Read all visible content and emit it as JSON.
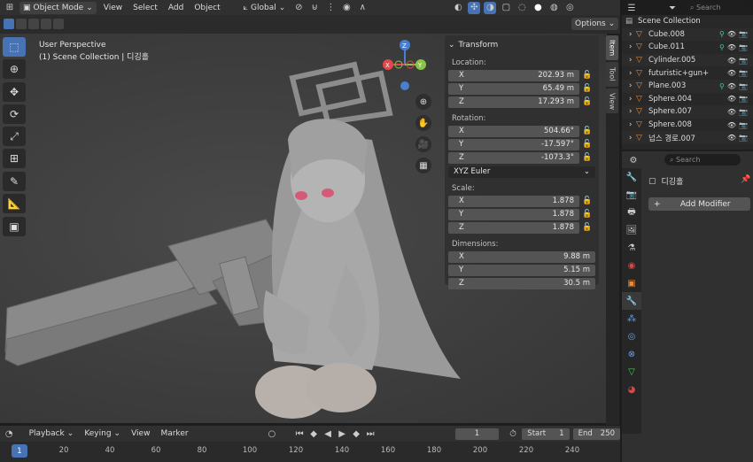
{
  "topbar": {
    "mode": "Object Mode",
    "menus": [
      "View",
      "Select",
      "Add",
      "Object"
    ],
    "orientation": "Global",
    "search_placeholder": "Search"
  },
  "viewport": {
    "view_name": "User Perspective",
    "context": "(1) Scene Collection | 디깅홀",
    "options_label": "Options"
  },
  "gizmo": {
    "x": "X",
    "y": "Y",
    "z": "Z"
  },
  "npanel": {
    "tabs": [
      "Item",
      "Tool",
      "View"
    ],
    "section": "Transform",
    "location_label": "Location:",
    "location": [
      {
        "axis": "X",
        "value": "202.93 m"
      },
      {
        "axis": "Y",
        "value": "65.49 m"
      },
      {
        "axis": "Z",
        "value": "17.293 m"
      }
    ],
    "rotation_label": "Rotation:",
    "rotation": [
      {
        "axis": "X",
        "value": "504.66°"
      },
      {
        "axis": "Y",
        "value": "-17.597°"
      },
      {
        "axis": "Z",
        "value": "-1073.3°"
      }
    ],
    "rotation_mode": "XYZ Euler",
    "scale_label": "Scale:",
    "scale": [
      {
        "axis": "X",
        "value": "1.878"
      },
      {
        "axis": "Y",
        "value": "1.878"
      },
      {
        "axis": "Z",
        "value": "1.878"
      }
    ],
    "dimensions_label": "Dimensions:",
    "dimensions": [
      {
        "axis": "X",
        "value": "9.88 m"
      },
      {
        "axis": "Y",
        "value": "5.15 m"
      },
      {
        "axis": "Z",
        "value": "30.5 m"
      }
    ]
  },
  "outliner": {
    "root": "Scene Collection",
    "items": [
      "Cube.008",
      "Cube.011",
      "Cylinder.005",
      "futuristic+gun+",
      "Plane.003",
      "Sphere.004",
      "Sphere.007",
      "Sphere.008",
      "넙스 경로.007"
    ]
  },
  "properties": {
    "search_placeholder": "Search",
    "object_name": "디깅홀",
    "add_modifier": "Add Modifier"
  },
  "timeline": {
    "playback": "Playback",
    "keying": "Keying",
    "view": "View",
    "marker": "Marker",
    "current_frame": "1",
    "start_label": "Start",
    "start": "1",
    "end_label": "End",
    "end": "250",
    "ruler": [
      "1",
      "20",
      "40",
      "60",
      "80",
      "100",
      "120",
      "140",
      "160",
      "180",
      "200",
      "220",
      "240"
    ]
  },
  "colors": {
    "accent": "#4772b3",
    "x_axis": "#e0484c",
    "y_axis": "#8bc34a",
    "z_axis": "#4a7fd0"
  }
}
